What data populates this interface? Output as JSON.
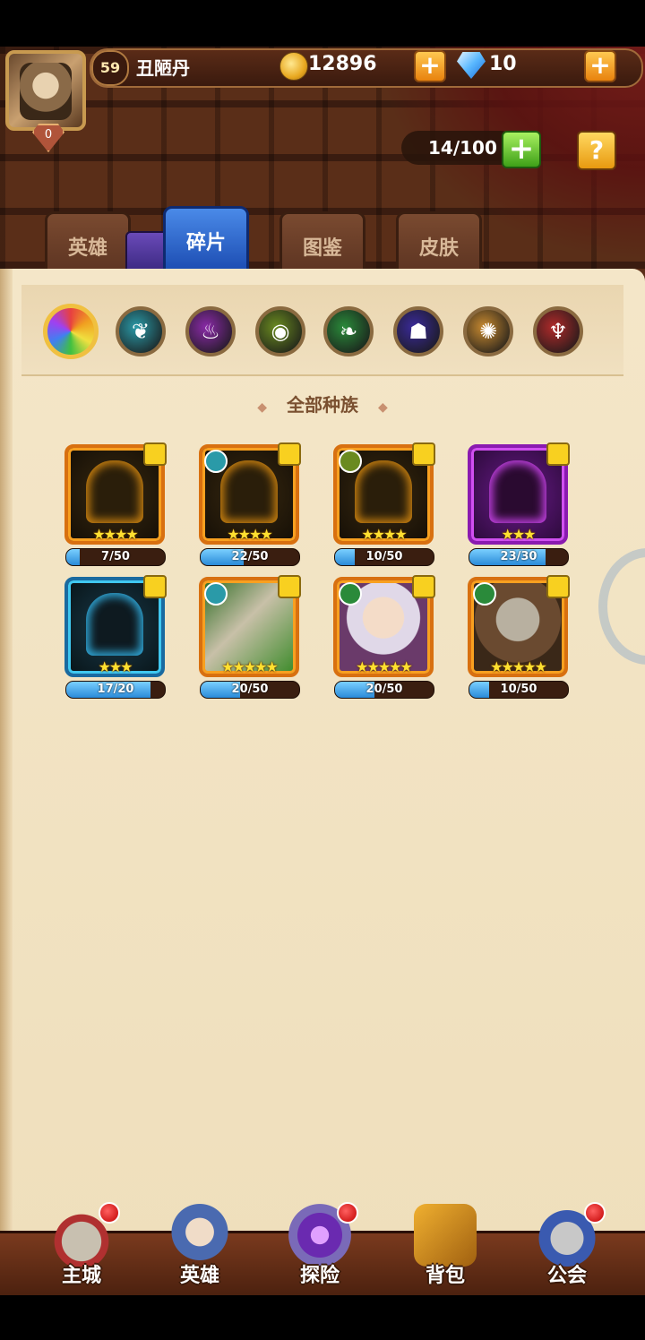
{
  "player": {
    "level": "59",
    "name": "丑陋丹",
    "vip": "0",
    "gold": "12896",
    "gems": "10"
  },
  "inventory": {
    "capacity": "14/100",
    "help": "?"
  },
  "tabs": [
    {
      "label": "英雄",
      "active": false
    },
    {
      "label": "碎片",
      "active": true
    },
    {
      "label": "图鉴",
      "active": false
    },
    {
      "label": "皮肤",
      "active": false
    }
  ],
  "race_filter": {
    "selected_label": "全部种族",
    "icons": [
      "all-races-icon",
      "forest-race-icon",
      "shadow-race-icon",
      "fortress-race-icon",
      "nature-race-icon",
      "abyss-race-icon",
      "light-race-icon",
      "dark-race-icon"
    ],
    "colors": [
      "#e84040",
      "#2a9aa8",
      "#8a2aa8",
      "#6a8a20",
      "#2a8a3a",
      "#3a2a9a",
      "#c88a30",
      "#b02a2a"
    ]
  },
  "fragments": [
    {
      "frame": "orange",
      "stars": "★★★★",
      "progress": "7/50",
      "fraction": 0.14,
      "race": "none"
    },
    {
      "frame": "orange",
      "stars": "★★★★",
      "progress": "22/50",
      "fraction": 0.44,
      "race": "forest"
    },
    {
      "frame": "orange",
      "stars": "★★★★",
      "progress": "10/50",
      "fraction": 0.2,
      "race": "fortress"
    },
    {
      "frame": "purple",
      "stars": "★★★",
      "progress": "23/30",
      "fraction": 0.77,
      "race": "none"
    },
    {
      "frame": "blue",
      "stars": "★★★",
      "progress": "17/20",
      "fraction": 0.85,
      "race": "none"
    },
    {
      "frame": "portrait-green",
      "stars": "★★★★★",
      "progress": "20/50",
      "fraction": 0.4,
      "race": "forest"
    },
    {
      "frame": "portrait-elf",
      "stars": "★★★★★",
      "progress": "20/50",
      "fraction": 0.4,
      "race": "nature"
    },
    {
      "frame": "portrait-dwarf",
      "stars": "★★★★★",
      "progress": "10/50",
      "fraction": 0.2,
      "race": "nature"
    }
  ],
  "bottom_nav": [
    {
      "label": "主城",
      "icon": "castle-icon",
      "badge": true
    },
    {
      "label": "英雄",
      "icon": "hero-icon",
      "badge": false
    },
    {
      "label": "探险",
      "icon": "portal-icon",
      "badge": true
    },
    {
      "label": "背包",
      "icon": "backpack-icon",
      "badge": false
    },
    {
      "label": "公会",
      "icon": "guild-icon",
      "badge": true
    }
  ]
}
